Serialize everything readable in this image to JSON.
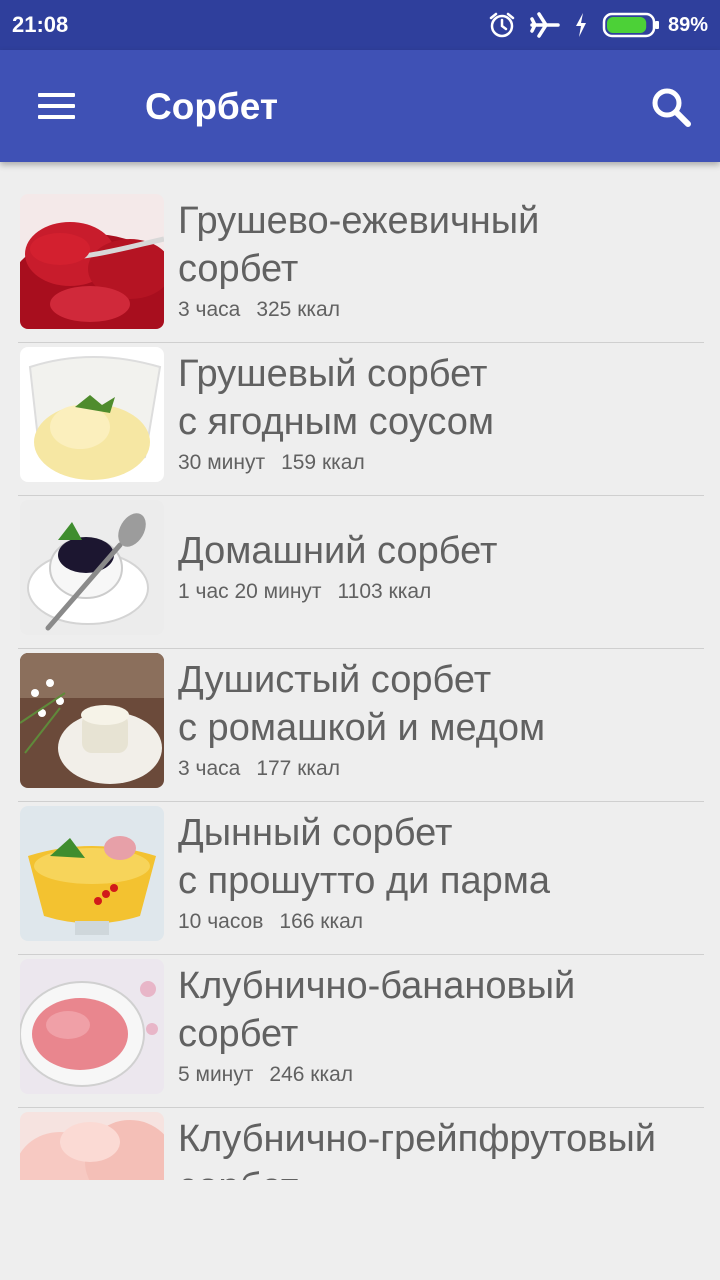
{
  "status_bar": {
    "time": "21:08",
    "battery_percent": "89%",
    "battery_level": 0.89,
    "icons": [
      "alarm-icon",
      "airplane-mode-icon",
      "charging-icon",
      "battery-icon"
    ]
  },
  "app_bar": {
    "title": "Сорбет",
    "color": "#3f51b5",
    "icons": [
      "menu-icon",
      "search-icon"
    ]
  },
  "recipes": [
    {
      "title": "Грушево-ежевичный\nсорбет",
      "time": "3 часа",
      "calories": "325 ккал"
    },
    {
      "title": "Грушевый сорбет\nс ягодным соусом",
      "time": "30 минут",
      "calories": "159 ккал"
    },
    {
      "title": "Домашний сорбет",
      "time": "1 час 20 минут",
      "calories": "1103 ккал"
    },
    {
      "title": "Душистый сорбет\nс ромашкой и медом",
      "time": "3 часа",
      "calories": "177 ккал"
    },
    {
      "title": "Дынный сорбет\nс прошутто ди парма",
      "time": "10 часов",
      "calories": "166 ккал"
    },
    {
      "title": "Клубнично-банановый\nсорбет",
      "time": "5 минут",
      "calories": "246 ккал"
    },
    {
      "title": "Клубнично-грейпфрутовый\nсорбет",
      "time": "",
      "calories": ""
    }
  ]
}
